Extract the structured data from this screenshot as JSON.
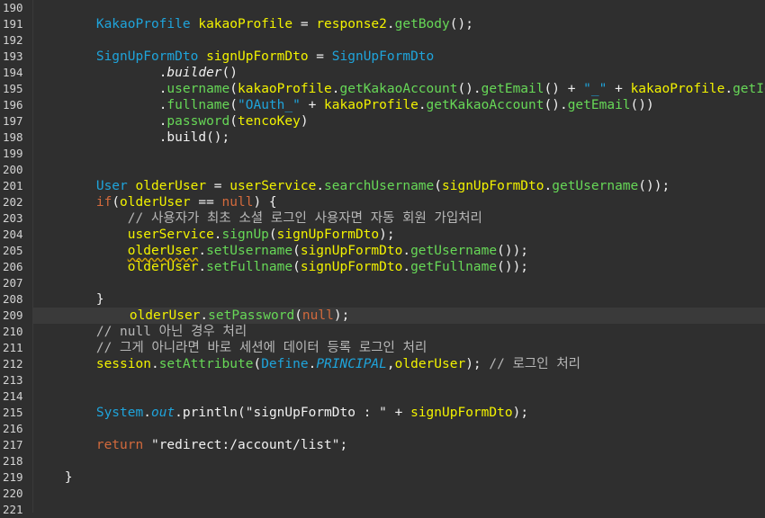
{
  "editor": {
    "colors": {
      "background": "#2f2f2f",
      "current_line": "#3a3a3a",
      "type": "#1fa4db",
      "variable": "#f2f200",
      "method": "#67d857",
      "keyword": "#d36a3c",
      "comment": "#b8b8b8"
    },
    "current_line_number": "209",
    "lines": [
      {
        "n": "190",
        "tokens": []
      },
      {
        "n": "191",
        "tokens": [
          [
            "        ",
            "p"
          ],
          [
            "KakaoProfile",
            "type"
          ],
          [
            " ",
            "p"
          ],
          [
            "kakaoProfile",
            "var"
          ],
          [
            " = ",
            "p"
          ],
          [
            "response2",
            "var"
          ],
          [
            ".",
            "p"
          ],
          [
            "getBody",
            "method"
          ],
          [
            "();",
            "p"
          ]
        ]
      },
      {
        "n": "192",
        "tokens": []
      },
      {
        "n": "193",
        "tokens": [
          [
            "        ",
            "p"
          ],
          [
            "SignUpFormDto",
            "type"
          ],
          [
            " ",
            "p"
          ],
          [
            "signUpFormDto",
            "var"
          ],
          [
            " = ",
            "p"
          ],
          [
            "SignUpFormDto",
            "type"
          ]
        ]
      },
      {
        "n": "194",
        "tokens": [
          [
            "                ",
            "p"
          ],
          [
            ".",
            "p"
          ],
          [
            "builder",
            "italic"
          ],
          [
            "()",
            "p"
          ]
        ]
      },
      {
        "n": "195",
        "tokens": [
          [
            "                ",
            "p"
          ],
          [
            ".",
            "p"
          ],
          [
            "username",
            "method"
          ],
          [
            "(",
            "p"
          ],
          [
            "kakaoProfile",
            "var"
          ],
          [
            ".",
            "p"
          ],
          [
            "getKakaoAccount",
            "method"
          ],
          [
            "().",
            "p"
          ],
          [
            "getEmail",
            "method"
          ],
          [
            "() + ",
            "p"
          ],
          [
            "\"_\"",
            "str"
          ],
          [
            " + ",
            "p"
          ],
          [
            "kakaoProfile",
            "var"
          ],
          [
            ".",
            "p"
          ],
          [
            "getId",
            "method"
          ],
          [
            "())",
            "p"
          ]
        ]
      },
      {
        "n": "196",
        "tokens": [
          [
            "                ",
            "p"
          ],
          [
            ".",
            "p"
          ],
          [
            "fullname",
            "method"
          ],
          [
            "(",
            "p"
          ],
          [
            "\"OAuth_\"",
            "str"
          ],
          [
            " + ",
            "p"
          ],
          [
            "kakaoProfile",
            "var"
          ],
          [
            ".",
            "p"
          ],
          [
            "getKakaoAccount",
            "method"
          ],
          [
            "().",
            "p"
          ],
          [
            "getEmail",
            "method"
          ],
          [
            "())",
            "p"
          ]
        ]
      },
      {
        "n": "197",
        "tokens": [
          [
            "                ",
            "p"
          ],
          [
            ".",
            "p"
          ],
          [
            "password",
            "method"
          ],
          [
            "(",
            "p"
          ],
          [
            "tencoKey",
            "var"
          ],
          [
            ")",
            "p"
          ]
        ]
      },
      {
        "n": "198",
        "tokens": [
          [
            "                ",
            "p"
          ],
          [
            ".build();",
            "p"
          ]
        ]
      },
      {
        "n": "199",
        "tokens": []
      },
      {
        "n": "200",
        "tokens": []
      },
      {
        "n": "201",
        "tokens": [
          [
            "        ",
            "p"
          ],
          [
            "User",
            "type"
          ],
          [
            " ",
            "p"
          ],
          [
            "olderUser",
            "var"
          ],
          [
            " = ",
            "p"
          ],
          [
            "userService",
            "var"
          ],
          [
            ".",
            "p"
          ],
          [
            "searchUsername",
            "method"
          ],
          [
            "(",
            "p"
          ],
          [
            "signUpFormDto",
            "var"
          ],
          [
            ".",
            "p"
          ],
          [
            "getUsername",
            "method"
          ],
          [
            "());",
            "p"
          ]
        ]
      },
      {
        "n": "202",
        "tokens": [
          [
            "        ",
            "p"
          ],
          [
            "if",
            "kw"
          ],
          [
            "(",
            "p"
          ],
          [
            "olderUser",
            "var"
          ],
          [
            " == ",
            "p"
          ],
          [
            "null",
            "kw"
          ],
          [
            ") {",
            "p"
          ]
        ]
      },
      {
        "n": "203",
        "tokens": [
          [
            "            ",
            "p"
          ],
          [
            "// 사용자가 최초 소셜 로그인 사용자면 자동 회원 가입처리",
            "comment"
          ]
        ]
      },
      {
        "n": "204",
        "tokens": [
          [
            "            ",
            "p"
          ],
          [
            "userService",
            "var"
          ],
          [
            ".",
            "p"
          ],
          [
            "signUp",
            "method"
          ],
          [
            "(",
            "p"
          ],
          [
            "signUpFormDto",
            "var"
          ],
          [
            ");",
            "p"
          ]
        ]
      },
      {
        "n": "205",
        "tokens": [
          [
            "            ",
            "p"
          ],
          [
            "olderUser",
            "warnvar"
          ],
          [
            ".",
            "p"
          ],
          [
            "setUsername",
            "method"
          ],
          [
            "(",
            "p"
          ],
          [
            "signUpFormDto",
            "var"
          ],
          [
            ".",
            "p"
          ],
          [
            "getUsername",
            "method"
          ],
          [
            "());",
            "p"
          ]
        ]
      },
      {
        "n": "206",
        "tokens": [
          [
            "            ",
            "p"
          ],
          [
            "olderUser",
            "var"
          ],
          [
            ".",
            "p"
          ],
          [
            "setFullname",
            "method"
          ],
          [
            "(",
            "p"
          ],
          [
            "signUpFormDto",
            "var"
          ],
          [
            ".",
            "p"
          ],
          [
            "getFullname",
            "method"
          ],
          [
            "());",
            "p"
          ]
        ]
      },
      {
        "n": "207",
        "tokens": []
      },
      {
        "n": "208",
        "tokens": [
          [
            "        ",
            "p"
          ],
          [
            "}",
            "p"
          ]
        ]
      },
      {
        "n": "209",
        "tokens": [
          [
            "        ",
            "p"
          ],
          [
            "olderUser",
            "var"
          ],
          [
            ".",
            "p"
          ],
          [
            "setPassword",
            "method"
          ],
          [
            "(",
            "p"
          ],
          [
            "null",
            "kw"
          ],
          [
            ");",
            "p"
          ]
        ]
      },
      {
        "n": "210",
        "tokens": [
          [
            "        ",
            "p"
          ],
          [
            "// null 아닌 경우 처리",
            "comment"
          ]
        ]
      },
      {
        "n": "211",
        "tokens": [
          [
            "        ",
            "p"
          ],
          [
            "// 그게 아니라면 바로 세션에 데이터 등록 로그인 처리",
            "comment"
          ]
        ]
      },
      {
        "n": "212",
        "tokens": [
          [
            "        ",
            "p"
          ],
          [
            "session",
            "var"
          ],
          [
            ".",
            "p"
          ],
          [
            "setAttribute",
            "method"
          ],
          [
            "(",
            "p"
          ],
          [
            "Define",
            "type"
          ],
          [
            ".",
            "p"
          ],
          [
            "PRINCIPAL",
            "static"
          ],
          [
            ",",
            "p"
          ],
          [
            "olderUser",
            "var"
          ],
          [
            "); ",
            "p"
          ],
          [
            "// 로그인 처리",
            "comment"
          ]
        ]
      },
      {
        "n": "213",
        "tokens": []
      },
      {
        "n": "214",
        "tokens": []
      },
      {
        "n": "215",
        "tokens": [
          [
            "        ",
            "p"
          ],
          [
            "System",
            "type"
          ],
          [
            ".",
            "p"
          ],
          [
            "out",
            "static"
          ],
          [
            ".",
            "p"
          ],
          [
            "println",
            "plain"
          ],
          [
            "(",
            "p"
          ],
          [
            "\"signUpFormDto : \"",
            "plain"
          ],
          [
            " + ",
            "p"
          ],
          [
            "signUpFormDto",
            "var"
          ],
          [
            ");",
            "p"
          ]
        ]
      },
      {
        "n": "216",
        "tokens": []
      },
      {
        "n": "217",
        "tokens": [
          [
            "        ",
            "p"
          ],
          [
            "return",
            "kw"
          ],
          [
            " ",
            "p"
          ],
          [
            "\"redirect:/account/list\"",
            "plain"
          ],
          [
            ";",
            "p"
          ]
        ]
      },
      {
        "n": "218",
        "tokens": []
      },
      {
        "n": "219",
        "tokens": [
          [
            "    ",
            "p"
          ],
          [
            "}",
            "p"
          ]
        ]
      },
      {
        "n": "220",
        "tokens": []
      },
      {
        "n": "221",
        "tokens": []
      }
    ]
  }
}
